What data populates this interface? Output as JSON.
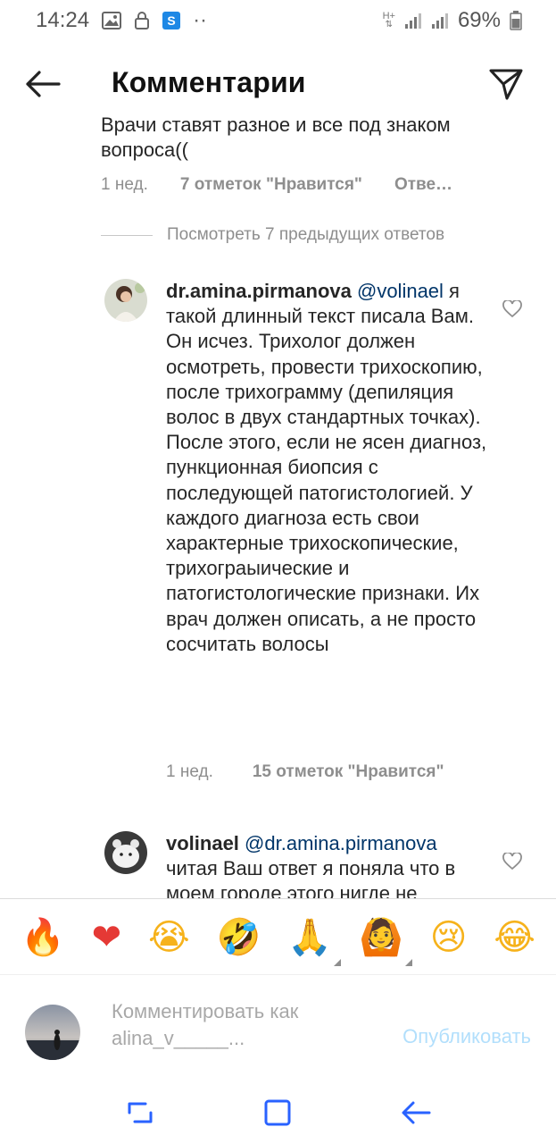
{
  "status_bar": {
    "time": "14:24",
    "network": "H+",
    "battery": "69%",
    "dots": "··"
  },
  "header": {
    "title": "Комментарии"
  },
  "top_comment": {
    "clipped_text": "Врачи ставят разное и все под знаком вопроса((",
    "time": "1 нед.",
    "likes": "7 отметок \"Нравится\"",
    "reply": "Отве…"
  },
  "view_replies": "Посмотреть 7 предыдущих ответов",
  "replies": [
    {
      "username": "dr.amina.pirmanova",
      "mention": "@volinael",
      "text": "я такой длинный текст писала Вам. Он исчез. Трихолог должен осмотреть, провести трихоскопию, после трихограмму (депиляция волос в двух стандартных точках). После этого, если не ясен диагноз, пункционная биопсия с последующей патогистологией. У каждого диагноза есть свои характерные трихоскопические, трихограыические и патогистологические признаки. Их врач должен описать, а не просто сосчитать волосы",
      "time": "1 нед.",
      "likes": "15 отметок \"Нравится\""
    },
    {
      "username": "volinael",
      "mention": "@dr.amina.pirmanova",
      "text": "читая Ваш ответ я поняла что в моем городе этого нигде не"
    }
  ],
  "emojis": [
    "🔥",
    "❤",
    "😭",
    "🤣",
    "🙏",
    "🙆",
    "😢",
    "😂"
  ],
  "composer": {
    "placeholder": "Комментировать как alina_v_____...",
    "publish_label": "Опубликовать"
  },
  "colors": {
    "mention": "#003569",
    "muted": "#8e8e8e",
    "publish_disabled": "#b2dffc"
  }
}
